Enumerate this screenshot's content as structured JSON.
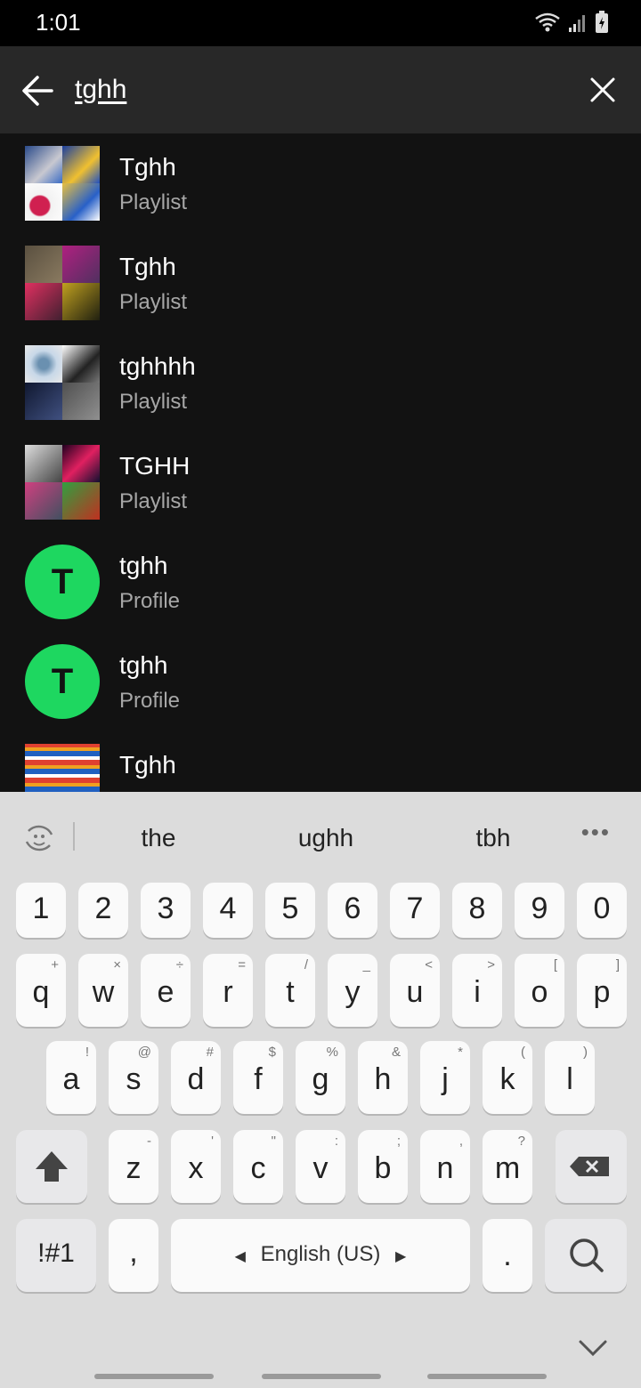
{
  "status_bar": {
    "time": "1:01"
  },
  "search": {
    "query": "tghh"
  },
  "results": [
    {
      "title": "Tghh",
      "subtitle": "Playlist",
      "type": "playlist"
    },
    {
      "title": "Tghh",
      "subtitle": "Playlist",
      "type": "playlist"
    },
    {
      "title": "tghhhh",
      "subtitle": "Playlist",
      "type": "playlist"
    },
    {
      "title": "TGHH",
      "subtitle": "Playlist",
      "type": "playlist"
    },
    {
      "title": "tghh",
      "subtitle": "Profile",
      "type": "profile",
      "avatar_letter": "T"
    },
    {
      "title": "tghh",
      "subtitle": "Profile",
      "type": "profile",
      "avatar_letter": "T"
    },
    {
      "title": "Tghh",
      "subtitle": "",
      "type": "playlist"
    }
  ],
  "keyboard": {
    "suggestions": [
      "the",
      "ughh",
      "tbh"
    ],
    "number_row": [
      "1",
      "2",
      "3",
      "4",
      "5",
      "6",
      "7",
      "8",
      "9",
      "0"
    ],
    "row1": {
      "keys": [
        "q",
        "w",
        "e",
        "r",
        "t",
        "y",
        "u",
        "i",
        "o",
        "p"
      ],
      "subs": [
        "+",
        "×",
        "÷",
        "=",
        "/",
        "_",
        "<",
        ">",
        "[",
        "]"
      ]
    },
    "row2": {
      "keys": [
        "a",
        "s",
        "d",
        "f",
        "g",
        "h",
        "j",
        "k",
        "l"
      ],
      "subs": [
        "!",
        "@",
        "#",
        "$",
        "%",
        "&",
        "*",
        "(",
        ")"
      ]
    },
    "row3": {
      "keys": [
        "z",
        "x",
        "c",
        "v",
        "b",
        "n",
        "m"
      ],
      "subs": [
        "-",
        "'",
        "\"",
        ":",
        ";",
        ",",
        "?"
      ]
    },
    "symbols_key": "!#1",
    "comma_key": ",",
    "space_label": "English (US)",
    "period_key": "."
  },
  "colors": {
    "accent": "#1ed760",
    "background": "#121212",
    "header": "#282828",
    "keyboard": "#dcdcdc"
  }
}
